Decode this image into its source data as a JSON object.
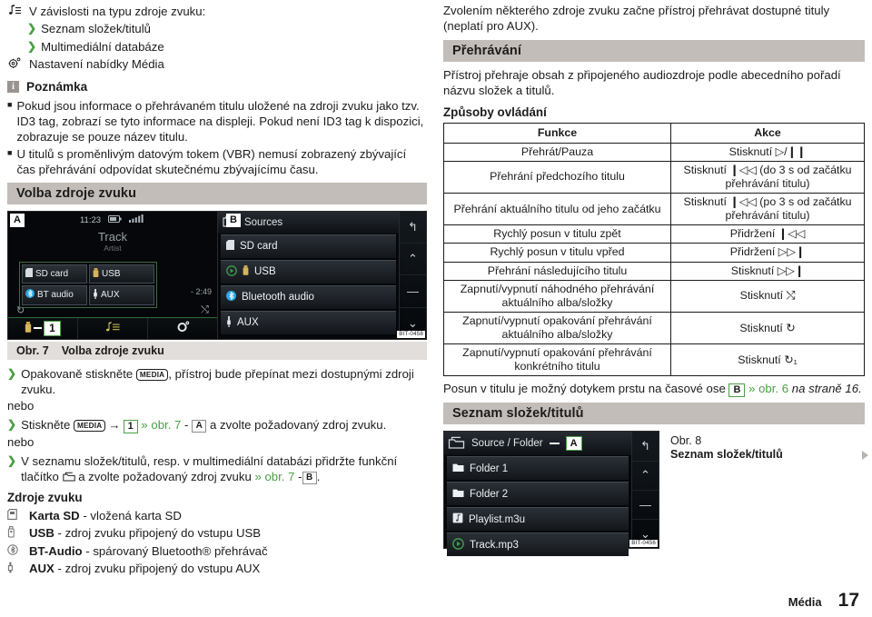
{
  "left": {
    "intro": {
      "lead": "V závislosti na typu zdroje zvuku:",
      "sub_items": [
        "Seznam složek/titulů",
        "Multimediální databáze"
      ],
      "settings_item": "Nastavení nabídky Média"
    },
    "note": {
      "title": "Poznámka",
      "items": [
        "Pokud jsou informace o přehrávaném titulu uložené na zdroji zvuku jako tzv. ID3 tag, zobrazí se tyto informace na displeji. Pokud není ID3 tag k dispozici, zobrazuje se pouze název titulu.",
        "U titulů s proměnlivým datovým tokem (VBR) nemusí zobrazený zbývající čas přehrávání odpovídat skutečnému zbývajícímu času."
      ]
    },
    "section_title": "Volba zdroje zvuku",
    "figure7": {
      "caption_label": "Obr. 7",
      "caption_text": "Volba zdroje zvuku",
      "tag_a": "A",
      "tag_b": "B",
      "bitcode": "BIT-0458",
      "screen_a": {
        "clock": "11:23",
        "track": "Track",
        "artist": "Artist",
        "time_remaining": "- 2:49",
        "popup_items": [
          "SD card",
          "USB",
          "BT audio",
          "AUX"
        ],
        "taskbar_number": "1"
      },
      "screen_b": {
        "title": "Sources",
        "items": [
          "SD card",
          "USB",
          "Bluetooth audio",
          "AUX"
        ]
      }
    },
    "steps": [
      {
        "pre": "Opakovaně stiskněte",
        "key": "MEDIA",
        "post": ", přístroj bude přepínat mezi dostupnými zdroji zvuku."
      }
    ],
    "or_label": "nebo",
    "step2": {
      "pre": "Stiskněte",
      "key": "MEDIA",
      "arrow": "→",
      "num": "1",
      "link": "» obr. 7",
      "dash": "-",
      "tag": "A",
      "post": "a zvolte požadovaný zdroj zvuku."
    },
    "step3": {
      "pre": "V seznamu složek/titulů, resp. v multimediální databázi přidržte funkční tlačítko",
      "post": "a zvolte požadovaný zdroj zvuku",
      "link": "» obr. 7",
      "dash": "-",
      "tag": "B",
      "end": "."
    },
    "sources_title": "Zdroje zvuku",
    "sources": [
      {
        "icon": "sd-card-icon",
        "bold": "Karta SD",
        "rest": "- vložená karta SD"
      },
      {
        "icon": "usb-icon",
        "bold": "USB",
        "rest": "- zdroj zvuku připojený do vstupu USB"
      },
      {
        "icon": "bluetooth-icon",
        "bold": "BT-Audio",
        "rest": "- spárovaný Bluetooth® přehrávač"
      },
      {
        "icon": "aux-icon",
        "bold": "AUX",
        "rest": "- zdroj zvuku připojený do vstupu AUX"
      }
    ]
  },
  "right": {
    "lead": "Zvolením některého zdroje zvuku začne přístroj přehrávat dostupné tituly (neplatí pro AUX).",
    "section_title": "Přehrávání",
    "para": "Přístroj přehraje obsah z připojeného audiozdroje podle abecedního pořadí názvu složek a titulů.",
    "table_title": "Způsoby ovládání",
    "table": {
      "headers": [
        "Funkce",
        "Akce"
      ],
      "rows": [
        {
          "fn": "Přehrát/Pauza",
          "act": "Stisknutí ▷/❙❙"
        },
        {
          "fn": "Přehrání předchozího titulu",
          "act": "Stisknutí ❙◁◁ (do 3 s od začátku přehrávání titulu)"
        },
        {
          "fn": "Přehrání aktuálního titulu od jeho začátku",
          "act": "Stisknutí ❙◁◁ (po 3 s od začátku přehrávání titulu)"
        },
        {
          "fn": "Rychlý posun v titulu zpět",
          "act": "Přidržení ❙◁◁"
        },
        {
          "fn": "Rychlý posun v titulu vpřed",
          "act": "Přidržení ▷▷❙"
        },
        {
          "fn": "Přehrání následujícího titulu",
          "act": "Stisknutí ▷▷❙"
        },
        {
          "fn": "Zapnutí/vypnutí náhodného přehrávání aktuálního alba/složky",
          "act": "Stisknutí ⤭"
        },
        {
          "fn": "Zapnutí/vypnutí opakování přehrávání aktuálního alba/složky",
          "act": "Stisknutí ↻"
        },
        {
          "fn": "Zapnutí/vypnutí opakování přehrávání konkrétního titulu",
          "act": "Stisknutí ↻₁"
        }
      ]
    },
    "crossref": {
      "pre": "Posun v titulu je možný dotykem prstu na časové ose",
      "tag": "B",
      "link": "» obr. 6",
      "italic": "na straně 16."
    },
    "section_title2": "Seznam složek/titulů",
    "figure8": {
      "caption_label": "Obr. 8",
      "caption_text": "Seznam složek/titulů",
      "tag_a": "A",
      "bitcode": "BIT-0456",
      "header": "Source / Folder",
      "items": [
        "Folder 1",
        "Folder 2",
        "Playlist.m3u",
        "Track.mp3"
      ]
    }
  },
  "footer": {
    "section": "Média",
    "page": "17"
  }
}
